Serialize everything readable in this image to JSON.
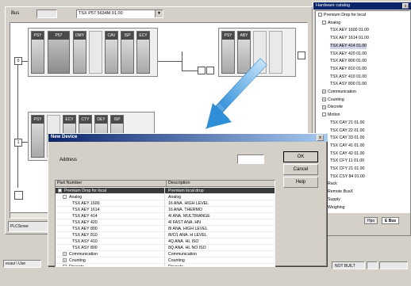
{
  "config": {
    "bus_label": "Bus",
    "processor": "TSX P57 5634M  01.00",
    "tab_label": "PLCScree"
  },
  "rack_top_left": {
    "modules": [
      "PSY",
      "P57",
      "DMY",
      "",
      "CAV",
      "ISP",
      "ECY"
    ]
  },
  "rack_top_right": {
    "modules": [
      "PSY",
      "ABY"
    ]
  },
  "rack_bottom": {
    "modules": [
      "PSY",
      "",
      "ECY",
      "CTY",
      "DEY",
      "ISP"
    ]
  },
  "catalog": {
    "title": "Hardware catalog",
    "close": "x",
    "tree": [
      {
        "text": "Premium Drop for local",
        "indent": 0,
        "box": "-"
      },
      {
        "text": "Analog",
        "indent": 1,
        "box": "-"
      },
      {
        "text": "TSX AEY 1600 01.00",
        "indent": 3
      },
      {
        "text": "TSX AEY 1614 01.00",
        "indent": 3
      },
      {
        "text": "TSX AEY 414 01.00",
        "indent": 3,
        "selected": true
      },
      {
        "text": "TSX AEY 420 01.00",
        "indent": 3
      },
      {
        "text": "TSX AEY 800 01.00",
        "indent": 3
      },
      {
        "text": "TSX AEY 810 01.00",
        "indent": 3
      },
      {
        "text": "TSX ASY 410 01.00",
        "indent": 3
      },
      {
        "text": "TSX ASY 800 01.00",
        "indent": 3
      },
      {
        "text": "Communication",
        "indent": 1,
        "box": "+"
      },
      {
        "text": "Counting",
        "indent": 1,
        "box": "+"
      },
      {
        "text": "Discrete",
        "indent": 1,
        "box": "+"
      },
      {
        "text": "Motion",
        "indent": 1,
        "box": "-"
      },
      {
        "text": "TSX CAY 21 01.00",
        "indent": 3
      },
      {
        "text": "TSX CAY 22 01.00",
        "indent": 3
      },
      {
        "text": "TSX CAY 33 01.00",
        "indent": 3
      },
      {
        "text": "TSX CAY 41 01.00",
        "indent": 3
      },
      {
        "text": "TSX CAY 42 01.00",
        "indent": 3
      },
      {
        "text": "TSX CFY 11 01.00",
        "indent": 3
      },
      {
        "text": "TSX CFY 21 01.00",
        "indent": 3
      },
      {
        "text": "TSX CSY 84 01.00",
        "indent": 3
      },
      {
        "text": "Rack",
        "indent": 1,
        "box": "+"
      },
      {
        "text": "Remote BusX",
        "indent": 1,
        "box": "+"
      },
      {
        "text": "Supply",
        "indent": 1,
        "box": "+"
      },
      {
        "text": "Weighing",
        "indent": 1,
        "box": "+"
      }
    ],
    "tabs": [
      "Hpo",
      "E Bus"
    ]
  },
  "statusbar": {
    "left_tab": "ecaui  \\ Use",
    "not_built": "NOT BUILT"
  },
  "dialog": {
    "title": "New Device",
    "close": "x",
    "address_label": "Address",
    "ok": "OK",
    "cancel": "Cancel",
    "help": "Help",
    "col_part": "Part Number",
    "col_desc": "Description",
    "rows": [
      {
        "part": "Premium Drop for local",
        "desc": "Premium local drop",
        "indent": 0,
        "box": "-",
        "selected": true
      },
      {
        "part": "Analog",
        "desc": "Analog",
        "indent": 1,
        "box": "-"
      },
      {
        "part": "TSX AEY 1600",
        "desc": "16 ANA. HIGH LEVEL",
        "indent": 3
      },
      {
        "part": "TSX AEY 1614",
        "desc": "16 ANA. THERMO",
        "indent": 3
      },
      {
        "part": "TSX AEY 414",
        "desc": "4I ANA. MULTIRANGE",
        "indent": 3
      },
      {
        "part": "TSX AEY 420",
        "desc": "4I FAST ANA. HN",
        "indent": 3
      },
      {
        "part": "TSX AEY 800",
        "desc": "8I ANA. HIGH LEVEL",
        "indent": 3
      },
      {
        "part": "TSX AEY 810",
        "desc": "8I/O1 ANA. H LEVEL",
        "indent": 3
      },
      {
        "part": "TSX ASY 410",
        "desc": "4Q ANA. HL ISO",
        "indent": 3
      },
      {
        "part": "TSX ASY 800",
        "desc": "8Q ANA. HL NO ISO",
        "indent": 3
      },
      {
        "part": "Communication",
        "desc": "Communication",
        "indent": 1,
        "box": "+"
      },
      {
        "part": "Counting",
        "desc": "Counting",
        "indent": 1,
        "box": "+"
      },
      {
        "part": "Discrete",
        "desc": "Discrete",
        "indent": 1,
        "box": "+"
      }
    ]
  },
  "colors": {
    "accent": "#0a246a",
    "arrow": "#3aa0e0"
  }
}
